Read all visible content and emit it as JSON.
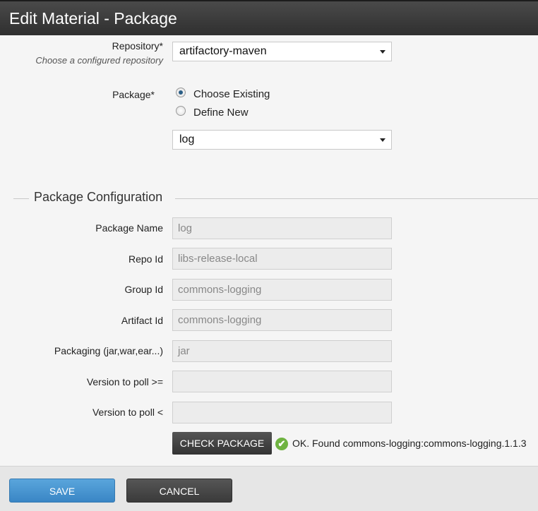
{
  "dialog": {
    "title": "Edit Material - Package"
  },
  "repository": {
    "label": "Repository*",
    "hint": "Choose a configured repository",
    "selected": "artifactory-maven"
  },
  "package": {
    "label": "Package*",
    "options": [
      "Choose Existing",
      "Define New"
    ],
    "selected_option": "Choose Existing",
    "selected": "log"
  },
  "config": {
    "legend": "Package Configuration",
    "fields": [
      {
        "label": "Package Name",
        "value": "log"
      },
      {
        "label": "Repo Id",
        "value": "libs-release-local"
      },
      {
        "label": "Group Id",
        "value": "commons-logging"
      },
      {
        "label": "Artifact Id",
        "value": "commons-logging"
      },
      {
        "label": "Packaging (jar,war,ear...)",
        "value": "jar"
      },
      {
        "label": "Version to poll >=",
        "value": ""
      },
      {
        "label": "Version to poll <",
        "value": ""
      }
    ],
    "check_button": "CHECK PACKAGE",
    "check_icon": "check-circle-icon",
    "check_result": "OK. Found commons-logging:commons-logging.1.1.3"
  },
  "footer": {
    "save_label": "SAVE",
    "cancel_label": "CANCEL"
  },
  "colors": {
    "accent": "#3a86c5",
    "success": "#6fb341",
    "titlebar": "#333333"
  }
}
